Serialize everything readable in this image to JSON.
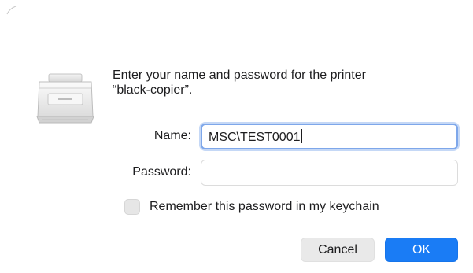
{
  "dialog": {
    "message_line1": "Enter your name and password for the printer",
    "message_line2": "“black-copier”."
  },
  "form": {
    "name_label": "Name:",
    "name_value": "MSC\\TEST0001",
    "password_label": "Password:",
    "password_value": ""
  },
  "checkbox": {
    "label": "Remember this password in my keychain",
    "checked": false
  },
  "buttons": {
    "cancel_label": "Cancel",
    "ok_label": "OK"
  },
  "colors": {
    "accent": "#1a7cf5",
    "focus_ring": "#7ea7ea"
  },
  "icons": {
    "printer": "printer-icon"
  }
}
